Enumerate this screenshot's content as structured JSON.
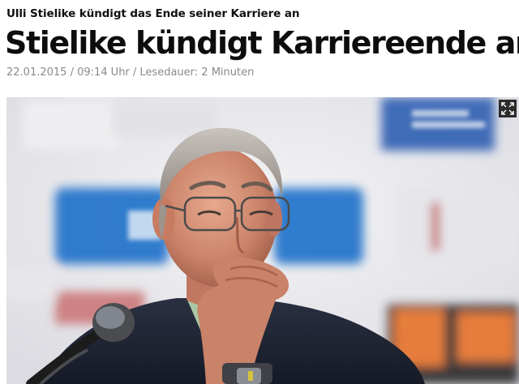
{
  "article": {
    "kicker": "Ulli Stielike kündigt das Ende seiner Karriere an",
    "headline": "Stielike kündigt Karriereende an",
    "meta": "22.01.2015 / 09:14 Uhr / Lesedauer: 2 Minuten"
  },
  "photo": {
    "subject": "press-conference-photo",
    "expand_icon": "expand-icon",
    "background_color": "#eaeaee",
    "sponsor_blue": "#1d6fc9"
  }
}
